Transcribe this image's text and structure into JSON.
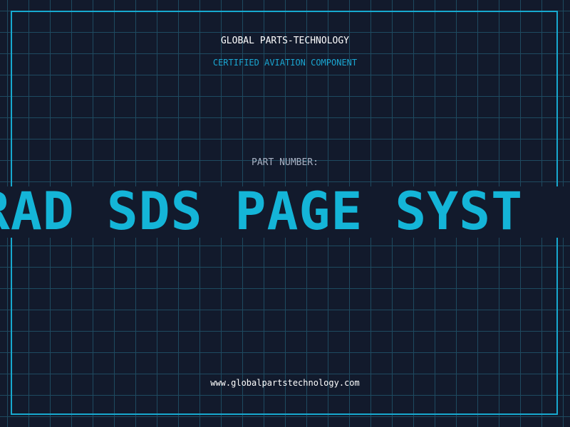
{
  "header": {
    "company": "GLOBAL PARTS-TECHNOLOGY",
    "tagline": "CERTIFIED AVIATION COMPONENT"
  },
  "part": {
    "label": "PART NUMBER:",
    "number": "D RAD SDS PAGE SYST"
  },
  "footer": {
    "url": "www.globalpartstechnology.com"
  },
  "colors": {
    "background": "#121a2c",
    "grid": "#1e4a60",
    "accent": "#17a9cf",
    "text": "#ffffff"
  }
}
